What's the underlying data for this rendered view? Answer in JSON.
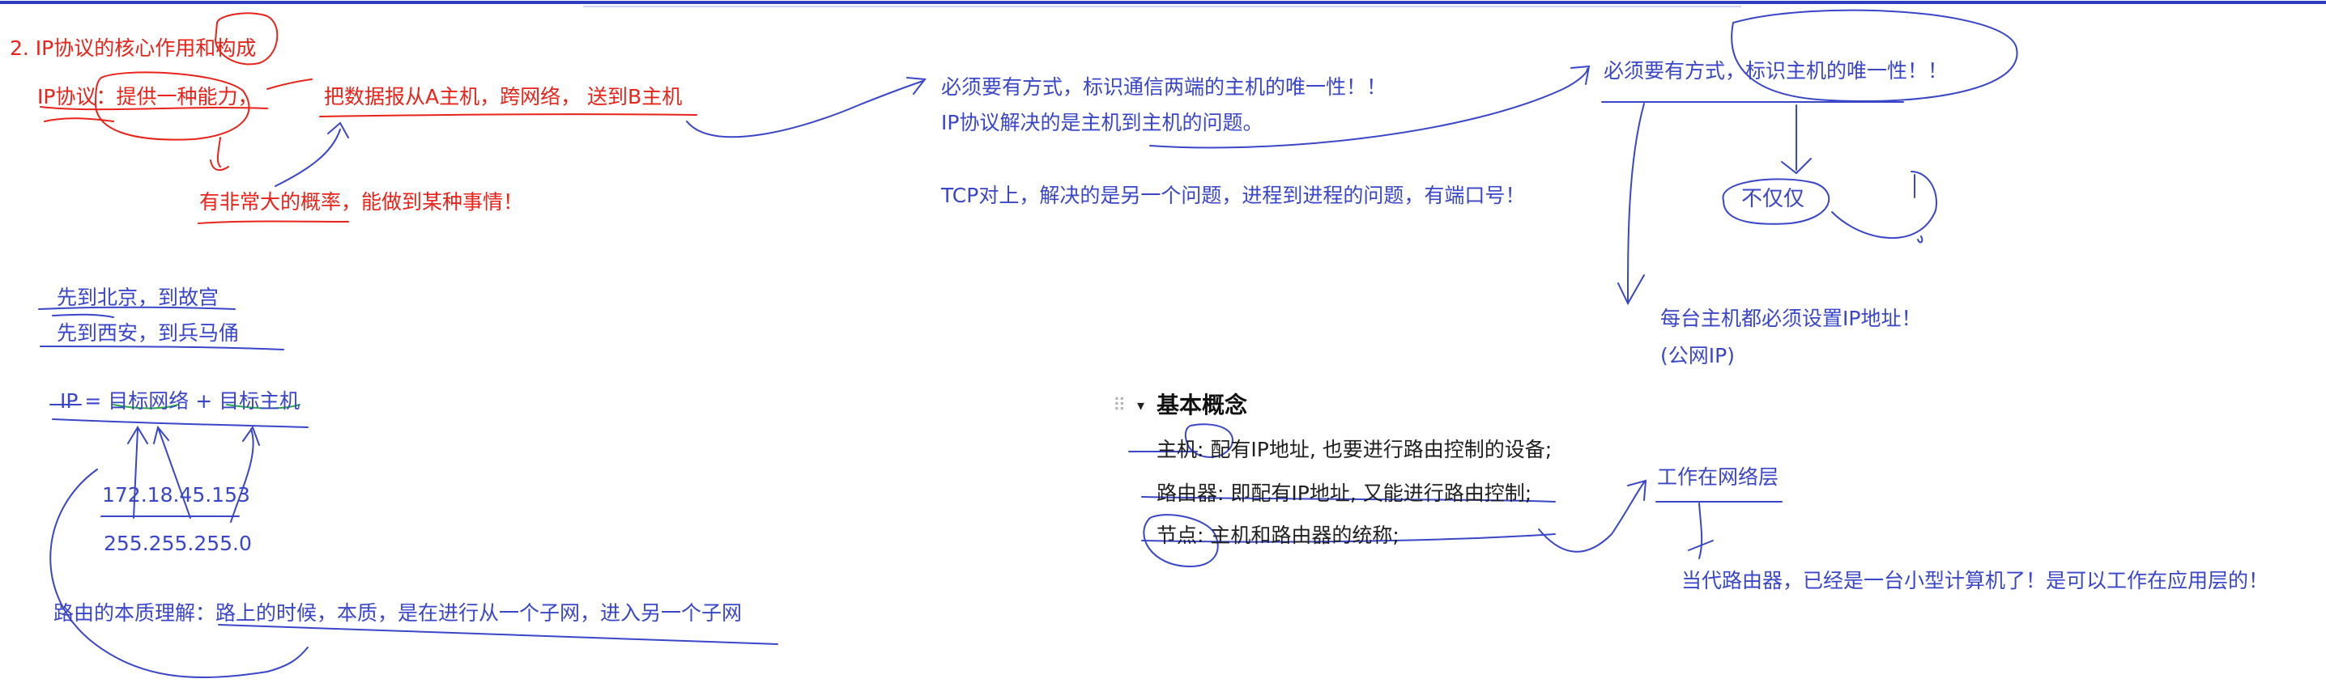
{
  "notes": {
    "title": "2. IP协议的核心作用和构成",
    "ip_capability": "IP协议：提供一种能力，",
    "send_datagram": "把数据报从A主机，跨网络， 送到B主机",
    "probability": "有非常大的概率，能做到某种事情！",
    "beijing": "先到北京，到故宫",
    "xian": "先到西安，到兵马俑",
    "ip_formula": "IP = 目标网络 + 目标主机",
    "ip_address": "172.18.45.153",
    "netmask": "255.255.255.0",
    "routing_essence": "路由的本质理解：路上的时候，本质，是在进行从一个子网，进入另一个子网",
    "unique_comm": "必须要有方式，标识通信两端的主机的唯一性！！",
    "host_to_host": "IP协议解决的是主机到主机的问题。",
    "tcp_note": "TCP对上，解决的是另一个问题，进程到进程的问题，有端口号！",
    "unique_host": "必须要有方式，标识主机的唯一性！！",
    "not_only": "不仅仅",
    "every_host_ip": "每台主机都必须设置IP地址！",
    "public_ip": "(公网IP)",
    "works_network_layer": "工作在网络层",
    "modern_router": "当代路由器，已经是一台小型计算机了！是可以工作在应用层的！"
  },
  "concepts": {
    "drag_handle": "⠿",
    "toggle": "▾",
    "heading": "基本概念",
    "host": "主机: 配有IP地址, 也要进行路由控制的设备;",
    "router": "路由器: 即配有IP地址, 又能进行路由控制;",
    "node": "节点: 主机和路由器的统称;"
  },
  "colors": {
    "red_ink": "#e8231a",
    "blue_ink": "#3a46c8",
    "top_rule": "#2e3dbf"
  }
}
